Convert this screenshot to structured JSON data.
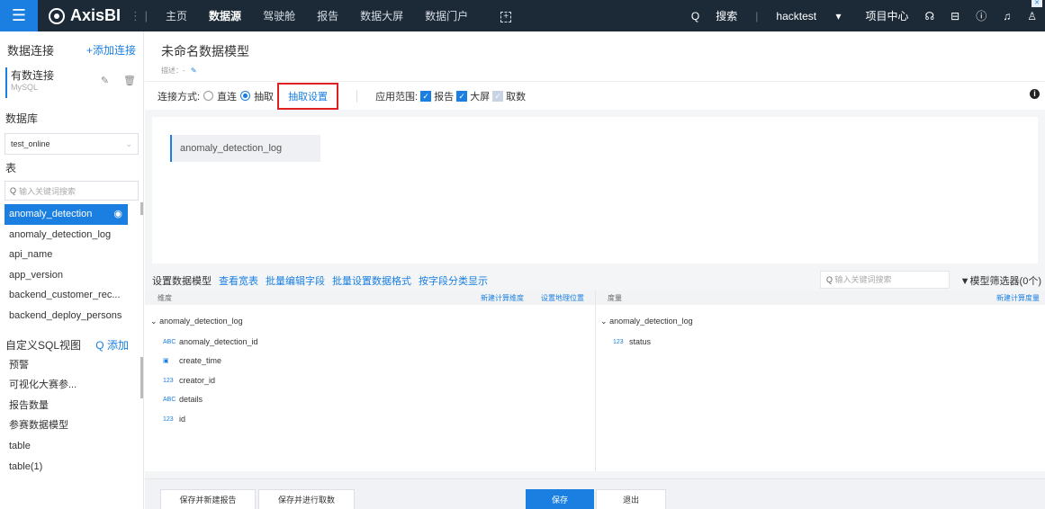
{
  "topbar": {
    "app_name": "AxisBI",
    "nav": [
      "主页",
      "数据源",
      "驾驶舱",
      "报告",
      "数据大屏",
      "数据门户"
    ],
    "active_nav": "数据源",
    "search_label": "搜索",
    "user": "hacktest",
    "project_center": "项目中心"
  },
  "sidebar": {
    "title": "数据连接",
    "add_connection": "+添加连接",
    "connection": {
      "name": "有数连接",
      "type": "MySQL"
    },
    "database_label": "数据库",
    "database_value": "test_online",
    "table_label": "表",
    "search_placeholder": "输入关键词搜索",
    "tables": [
      "anomaly_detection",
      "anomaly_detection_log",
      "api_name",
      "app_version",
      "backend_customer_rec...",
      "backend_deploy_persons"
    ],
    "sql_title": "自定义SQL视图",
    "sql_add": "添加",
    "sql_views": [
      "预警",
      "可视化大赛参...",
      "报告数量",
      "参赛数据模型",
      "table",
      "table(1)"
    ]
  },
  "model": {
    "title": "未命名数据模型",
    "desc_label": "描述：",
    "desc_value": "-",
    "mode_label": "连接方式:",
    "mode_direct": "直连",
    "mode_extract": "抽取",
    "extract_settings": "抽取设置",
    "scope_label": "应用范围:",
    "scope_report": "报告",
    "scope_screen": "大屏",
    "scope_fetch": "取数",
    "canvas_table": "anomaly_detection_log"
  },
  "toolbar": {
    "items": [
      "设置数据模型",
      "查看宽表",
      "批量编辑字段",
      "批量设置数据格式",
      "按字段分类显示"
    ],
    "search_placeholder": "输入关键词搜索",
    "filter": "模型筛选器(0个)"
  },
  "fields": {
    "dim_header": "维度",
    "new_dim": "新建计算维度",
    "geo": "设置地理位置",
    "measure_header": "度量",
    "new_measure": "新建计算度量",
    "dim_group": "anomaly_detection_log",
    "dimensions": [
      {
        "icon": "ABC",
        "name": "anomaly_detection_id"
      },
      {
        "icon": "date",
        "name": "create_time"
      },
      {
        "icon": "123",
        "name": "creator_id"
      },
      {
        "icon": "ABC",
        "name": "details"
      },
      {
        "icon": "123",
        "name": "id"
      }
    ],
    "measure_group": "anomaly_detection_log",
    "measures": [
      {
        "icon": "123",
        "name": "status"
      }
    ]
  },
  "footer": {
    "save_new_report": "保存并新建报告",
    "save_extract": "保存并进行取数",
    "save": "保存",
    "exit": "退出"
  }
}
